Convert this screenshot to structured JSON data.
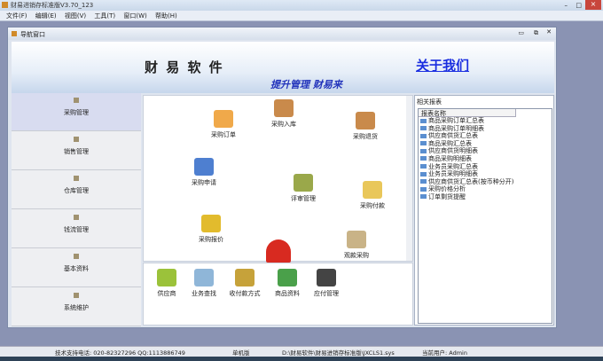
{
  "app": {
    "title": "财易进销存标准版V3.70_123"
  },
  "menu": [
    "文件(F)",
    "编辑(E)",
    "视图(V)",
    "工具(T)",
    "窗口(W)",
    "帮助(H)"
  ],
  "window": {
    "title": "导航窗口"
  },
  "banner": {
    "brand": "财 易 软 件",
    "slogan": "提升管理 财易来",
    "about": "关于我们"
  },
  "sidebar": [
    "采购管理",
    "销售管理",
    "仓库管理",
    "钱流管理",
    "基本资料",
    "系统维护"
  ],
  "functions": [
    "采购订单",
    "采购入库",
    "采购退货",
    "采购申请",
    "评审管理",
    "采购付款",
    "采购报价",
    "",
    "观款采购"
  ],
  "bottom": [
    "供应商",
    "业务查找",
    "收付款方式",
    "商品资料",
    "应付管理"
  ],
  "reports": {
    "title": "相关报表",
    "header": "报表名称",
    "items": [
      "商品采购订单汇总表",
      "商品采购订单明细表",
      "供应商供货汇总表",
      "商品采购汇总表",
      "供应商供货明细表",
      "商品采购明细表",
      "业务员采购汇总表",
      "业务员采购明细表",
      "供应商供货汇总表(按币种分开)",
      "采购价格分析",
      "订单剩货提醒"
    ]
  },
  "status": {
    "support": "技术支持电话: 020-82327296 QQ:1113886749",
    "mode": "单机版",
    "path": "D:\\财易软件\\财易进销存标准版\\JXCLS1.sys",
    "user": "当前用户: Admin"
  }
}
